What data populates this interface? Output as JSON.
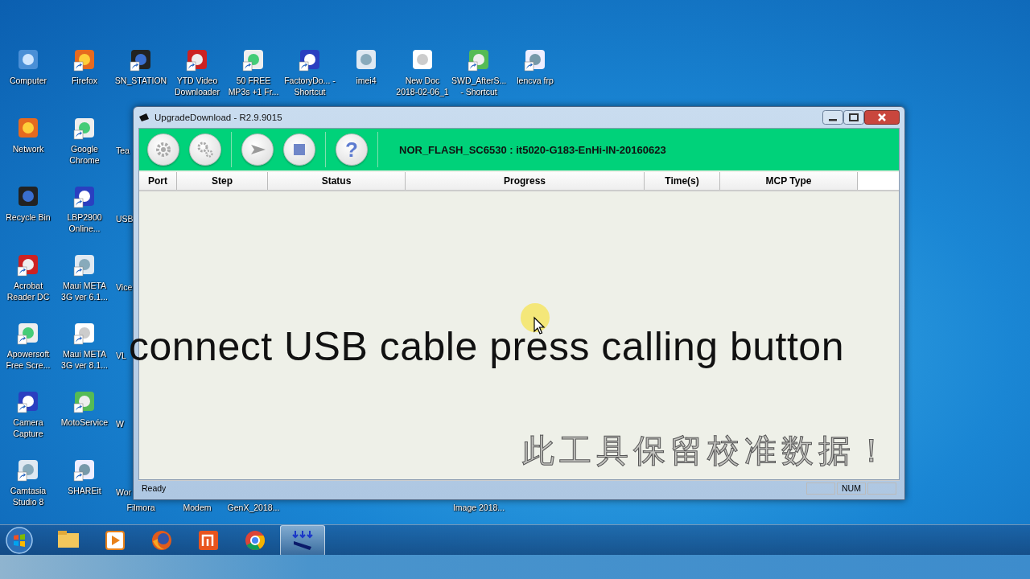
{
  "desktop": {
    "top_row": [
      {
        "label": "Computer",
        "shortcut": false
      },
      {
        "label": "Firefox",
        "shortcut": true
      },
      {
        "label": "SN_STATION",
        "shortcut": true
      },
      {
        "label": "YTD Video Downloader",
        "shortcut": true
      },
      {
        "label": "50 FREE MP3s +1 Fr...",
        "shortcut": true
      },
      {
        "label": "FactoryDo... - Shortcut",
        "shortcut": true
      },
      {
        "label": "imei4",
        "shortcut": false
      },
      {
        "label": "New Doc 2018-02-06_1",
        "shortcut": false
      },
      {
        "label": "SWD_AfterS... - Shortcut",
        "shortcut": true
      },
      {
        "label": "lencva frp",
        "shortcut": true
      }
    ],
    "columns": [
      [
        {
          "label": "Network",
          "shortcut": false
        },
        {
          "label": "Recycle Bin",
          "shortcut": false
        },
        {
          "label": "Acrobat Reader DC",
          "shortcut": true
        },
        {
          "label": "Apowersoft Free Scre...",
          "shortcut": true
        },
        {
          "label": "Camera Capture",
          "shortcut": true
        },
        {
          "label": "Camtasia Studio 8",
          "shortcut": true
        }
      ],
      [
        {
          "label": "Google Chrome",
          "shortcut": true
        },
        {
          "label": "LBP2900 Online...",
          "shortcut": true
        },
        {
          "label": "Maui META 3G ver 6.1...",
          "shortcut": true
        },
        {
          "label": "Maui META 3G ver 8.1...",
          "shortcut": true
        },
        {
          "label": "MotoService",
          "shortcut": true
        },
        {
          "label": "SHAREit",
          "shortcut": true
        }
      ],
      [
        {
          "label": "Tea"
        },
        {
          "label": "USB"
        },
        {
          "label": "Vice"
        },
        {
          "label": "VL"
        },
        {
          "label": "W"
        },
        {
          "label": "Wor"
        }
      ]
    ],
    "bottom_fragments": [
      "Filmora",
      "Modem",
      "GenX_2018...",
      "Image 2018..."
    ]
  },
  "window": {
    "title": "UpgradeDownload - R2.9.9015",
    "toolbar": [
      {
        "kind": "settings"
      },
      {
        "kind": "gears"
      },
      {
        "kind": "start"
      },
      {
        "kind": "stop"
      },
      {
        "kind": "help",
        "glyph": "?"
      }
    ],
    "firmware": "NOR_FLASH_SC6530 : it5020-G183-EnHi-IN-20160623",
    "columns": [
      "Port",
      "Step",
      "Status",
      "Progress",
      "Time(s)",
      "MCP Type"
    ],
    "background_text": "此工具保留校准数据！",
    "status_bar": {
      "text": "Ready",
      "panes": [
        "NUM"
      ]
    }
  },
  "caption": "connect USB cable press calling button",
  "taskbar": {
    "items": [
      {
        "kind": "folder",
        "selected": false
      },
      {
        "kind": "media",
        "selected": false
      },
      {
        "kind": "firefox",
        "selected": false
      },
      {
        "kind": "mi",
        "selected": false
      },
      {
        "kind": "chrome",
        "selected": false
      },
      {
        "kind": "download",
        "selected": true
      }
    ]
  }
}
